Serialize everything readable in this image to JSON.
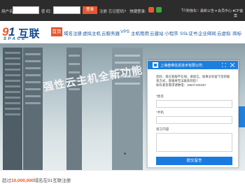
{
  "topbar": {
    "username_label": "用户名：",
    "password_label": "密  码：",
    "login_button": "登录",
    "register_link": "注册",
    "forgot_link": "忘记密码?",
    "quick_login_label": "快捷登录:",
    "cart_label": "购物车",
    "cart_count": "0",
    "news_label": "最新公告",
    "member_label": "会员中心",
    "icp_label": "ICP备案"
  },
  "nav": {
    "logo_text": "互联",
    "logo_sub": "SPACE",
    "items": [
      "首页",
      "域名注册",
      "虚拟主机",
      "云服务器",
      "VPS",
      "主机租用",
      "云建站",
      "小程序",
      "SSL证书",
      "企业邮局",
      "云虚拟",
      "商标"
    ]
  },
  "banner": {
    "title": "强性云主机全新功能"
  },
  "stat": {
    "prefix": "超过",
    "number": "10,000,000",
    "suffix": "域名在91互联注册"
  },
  "chat": {
    "title": "上海叁维信息技术有限公司",
    "greeting_1": "您好，现在客服不在线，请留言。如果没有留下您的联",
    "greeting_2": "系方式，客服将无法联系到您！",
    "phone_line": "如有紧急需求请致电：18637150220",
    "name_label": "*姓名",
    "phone_label": "*手机",
    "message_label": "留言内容",
    "submit_button": "提交留言"
  },
  "colors": {
    "accent": "#e8572e",
    "brand_blue": "#1c7fe0",
    "nav_text": "#1e5aa3"
  }
}
